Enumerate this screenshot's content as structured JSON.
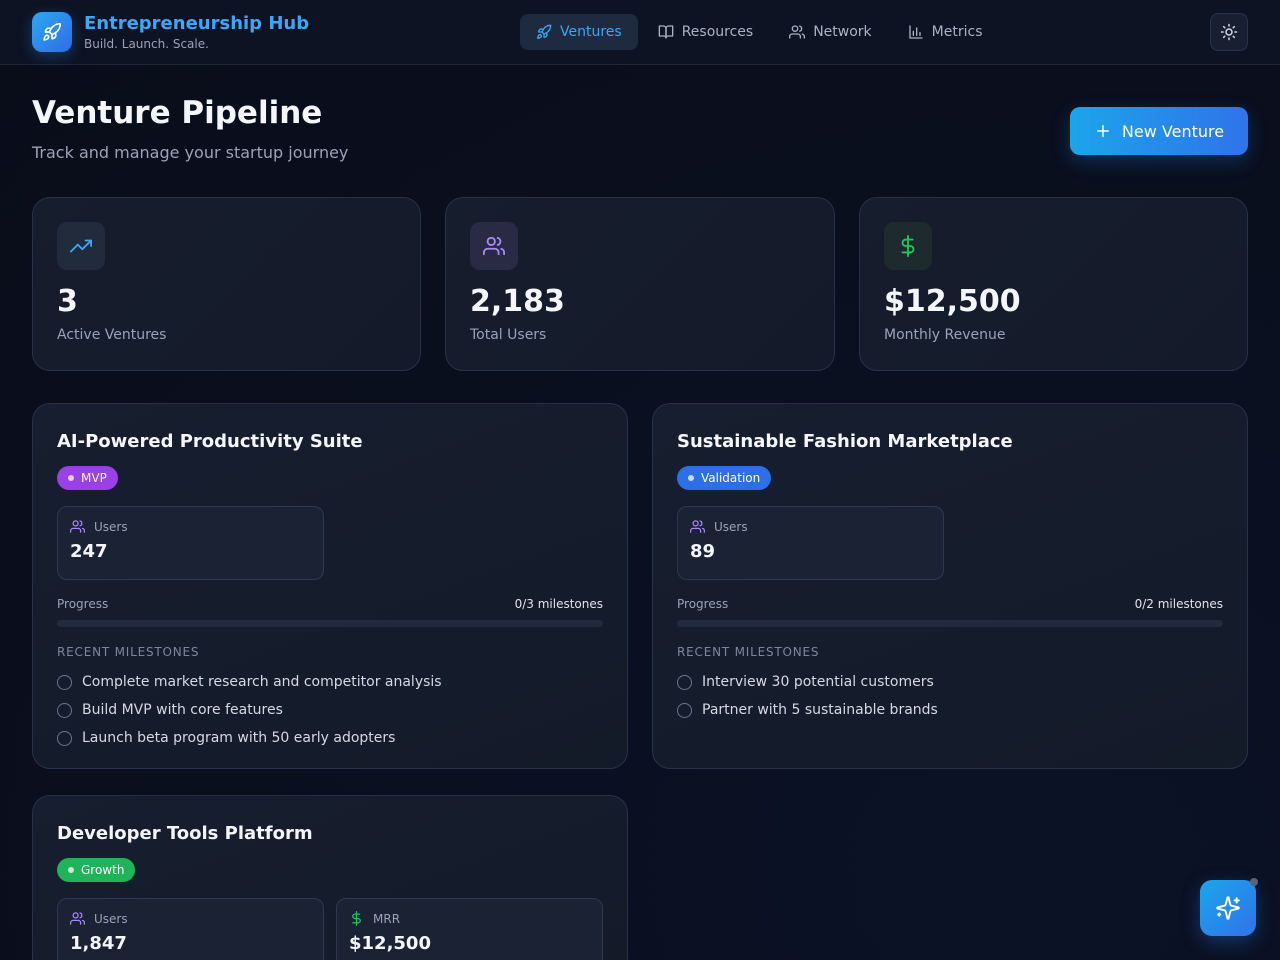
{
  "header": {
    "brand_name": "Entrepreneurship Hub",
    "brand_tagline": "Build. Launch. Scale.",
    "nav": [
      {
        "label": "Ventures",
        "icon": "rocket-icon",
        "active": true
      },
      {
        "label": "Resources",
        "icon": "book-icon",
        "active": false
      },
      {
        "label": "Network",
        "icon": "users-icon",
        "active": false
      },
      {
        "label": "Metrics",
        "icon": "bar-chart-icon",
        "active": false
      }
    ],
    "theme_toggle_icon": "sun-icon"
  },
  "page": {
    "title": "Venture Pipeline",
    "subtitle": "Track and manage your startup journey",
    "new_button_label": "New Venture"
  },
  "stats": [
    {
      "value": "3",
      "label": "Active Ventures",
      "icon": "trending-up-icon",
      "color": "#3aa8f5"
    },
    {
      "value": "2,183",
      "label": "Total Users",
      "icon": "users-icon",
      "color": "#a98bf5"
    },
    {
      "value": "$12,500",
      "label": "Monthly Revenue",
      "icon": "dollar-icon",
      "color": "#22c55e"
    }
  ],
  "ventures": [
    {
      "title": "AI-Powered Productivity Suite",
      "stage": "MVP",
      "stage_color": "#9b3fe6",
      "metrics": [
        {
          "label": "Users",
          "value": "247",
          "icon": "users-icon"
        }
      ],
      "progress_label": "Progress",
      "progress_text": "0/3 milestones",
      "progress": 0,
      "milestones_heading": "RECENT MILESTONES",
      "milestones": [
        "Complete market research and competitor analysis",
        "Build MVP with core features",
        "Launch beta program with 50 early adopters"
      ]
    },
    {
      "title": "Sustainable Fashion Marketplace",
      "stage": "Validation",
      "stage_color": "#2d6fe6",
      "metrics": [
        {
          "label": "Users",
          "value": "89",
          "icon": "users-icon"
        }
      ],
      "progress_label": "Progress",
      "progress_text": "0/2 milestones",
      "progress": 0,
      "milestones_heading": "RECENT MILESTONES",
      "milestones": [
        "Interview 30 potential customers",
        "Partner with 5 sustainable brands"
      ]
    },
    {
      "title": "Developer Tools Platform",
      "stage": "Growth",
      "stage_color": "#1fb45a",
      "metrics": [
        {
          "label": "Users",
          "value": "1,847",
          "icon": "users-icon"
        },
        {
          "label": "MRR",
          "value": "$12,500",
          "icon": "dollar-icon"
        }
      ]
    }
  ],
  "fab_icon": "sparkles-icon"
}
